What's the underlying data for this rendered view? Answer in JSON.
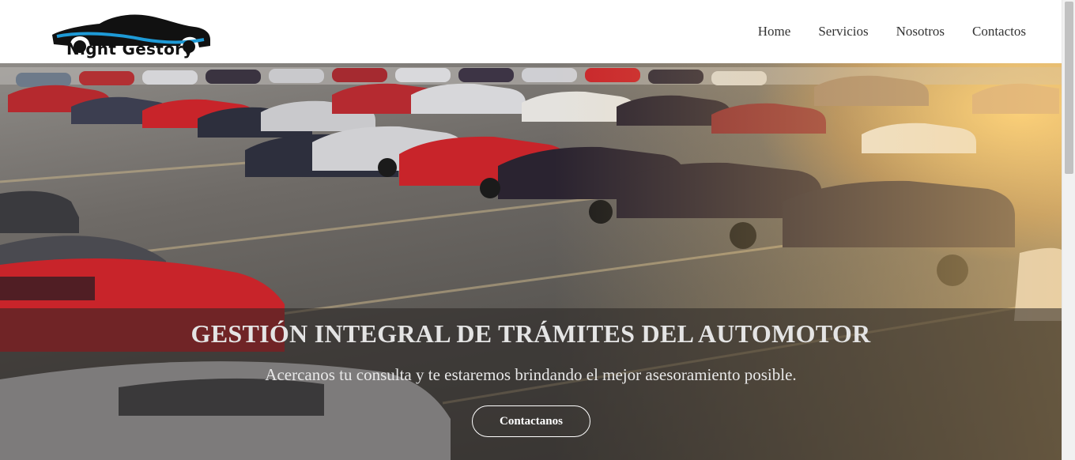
{
  "brand": {
    "name": "Night Gestory"
  },
  "nav": [
    {
      "label": "Home"
    },
    {
      "label": "Servicios"
    },
    {
      "label": "Nosotros"
    },
    {
      "label": "Contactos"
    }
  ],
  "hero": {
    "title": "GESTIÓN INTEGRAL DE TRÁMITES DEL AUTOMOTOR",
    "subtitle": "Acercanos tu consulta y te estaremos brindando el mejor asesoramiento posible.",
    "cta_label": "Contactanos"
  },
  "colors": {
    "accent": "#1e9ad6",
    "text": "#333333",
    "car_red": "#c8242a",
    "car_dark": "#2a2330",
    "car_silver": "#c9c9cc"
  }
}
